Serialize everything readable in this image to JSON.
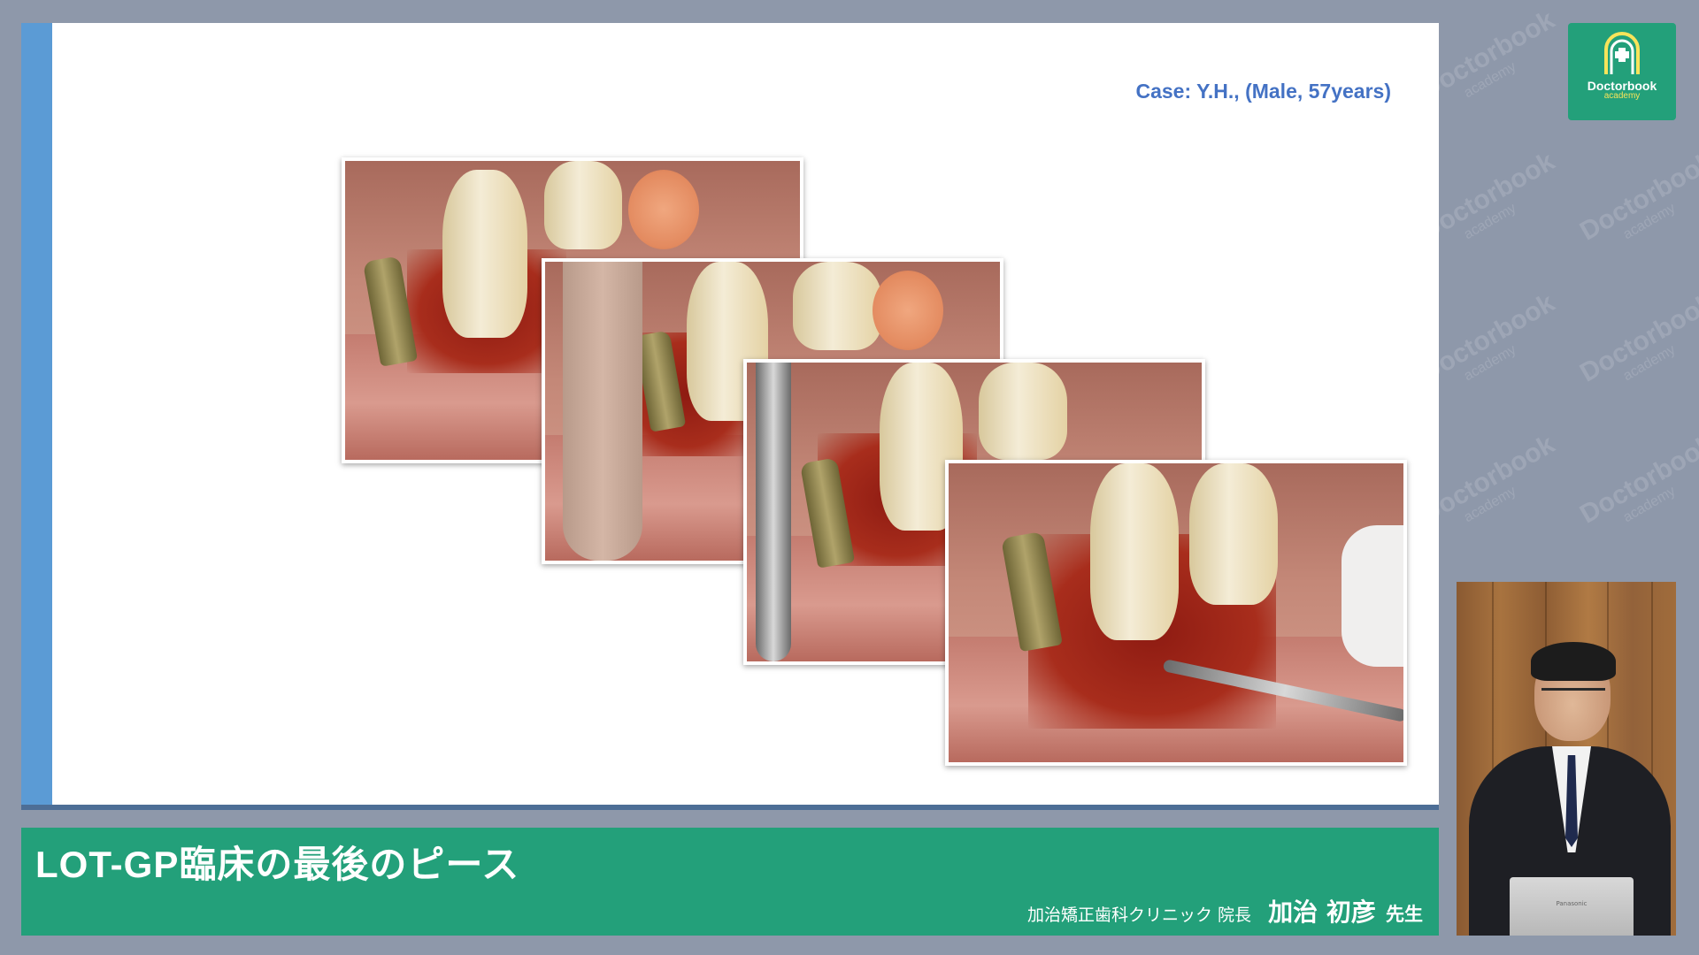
{
  "slide": {
    "case_label": "Case: Y.H., (Male, 57years)"
  },
  "banner": {
    "title": "LOT-GP臨床の最後のピース",
    "affiliation": "加治矯正歯科クリニック 院長",
    "presenter_name": "加治 初彦",
    "honorific": "先生"
  },
  "logo": {
    "name": "Doctorbook",
    "sub": "academy"
  },
  "watermark": {
    "text": "Doctorbook",
    "sub": "academy"
  },
  "webcam": {
    "laptop_brand": "Panasonic"
  },
  "colors": {
    "banner_green": "#23a07a",
    "slide_accent_blue": "#5b9bd5",
    "case_label_blue": "#4472c4",
    "background_gray": "#8e98aa"
  },
  "icons": [
    "doctorbook-logo-icon"
  ]
}
